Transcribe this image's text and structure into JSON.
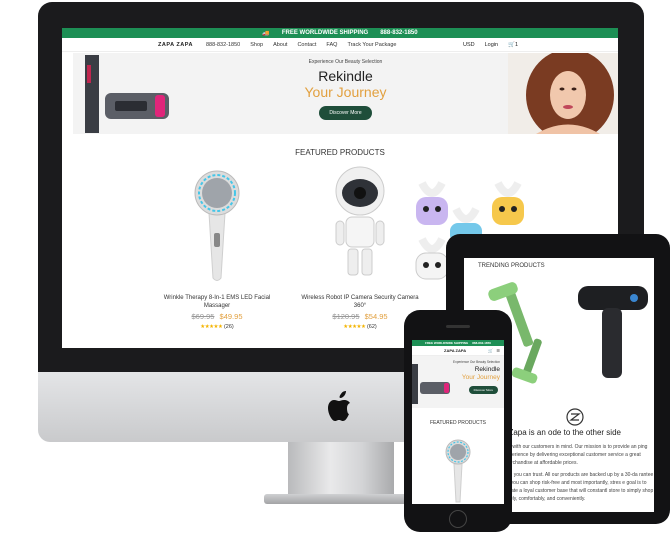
{
  "desktop": {
    "topbar": {
      "shipping": "FREE WORLDWIDE SHIPPING",
      "phone": "888-832-1850"
    },
    "nav": {
      "brand": "ZAPA ZAPA",
      "phone": "888-832-1850",
      "items": [
        "Shop",
        "About",
        "Contact",
        "FAQ",
        "Track Your Package"
      ],
      "currency": "USD",
      "login": "Login",
      "cart_count": "1"
    },
    "hero": {
      "sub": "Experience Our Beauty Selection",
      "title": "Rekindle",
      "accent": "Your Journey",
      "button": "Discover More"
    },
    "featured_title": "FEATURED PRODUCTS",
    "products": [
      {
        "name": "Wrinkle Therapy 8-In-1 EMS LED Facial Massager",
        "old_price": "$69.95",
        "new_price": "$49.95",
        "stars": "★★★★★",
        "reviews": "(26)"
      },
      {
        "name": "Wireless Robot IP Camera Security Camera 360°",
        "old_price": "$120.95",
        "new_price": "$54.95",
        "stars": "★★★★★",
        "reviews": "(62)"
      }
    ]
  },
  "tablet": {
    "trending_title": "TRENDING PRODUCTS",
    "about_title": "aZapa is an ode to the other side",
    "about_p1": "ted with our customers in mind. Our mission is to provide an ping experience by delivering exceptional customer service a great merchandise at affordable prices.",
    "about_p2": "and you can trust. All our products are backed up by a 30-da rantee so you can shop risk-free and most importantly, stres e goal is to create a loyal customer base that will constantl store to simply shop freely, comfortably, and conveniently."
  },
  "phone": {
    "topbar": {
      "shipping": "FREE WORLDWIDE SHIPPING",
      "phone": "888-832-1850"
    },
    "brand": "ZAPA ZAPA",
    "hero_sub": "Experience Our Beauty Selection",
    "hero_title": "Rekindle",
    "hero_accent": "Your Journey",
    "hero_button": "Discover More",
    "featured_title": "FEATURED PRODUCTS"
  },
  "colors": {
    "green": "#1d8f55",
    "dark_green": "#1f4e3a",
    "gold": "#e2a03f"
  }
}
